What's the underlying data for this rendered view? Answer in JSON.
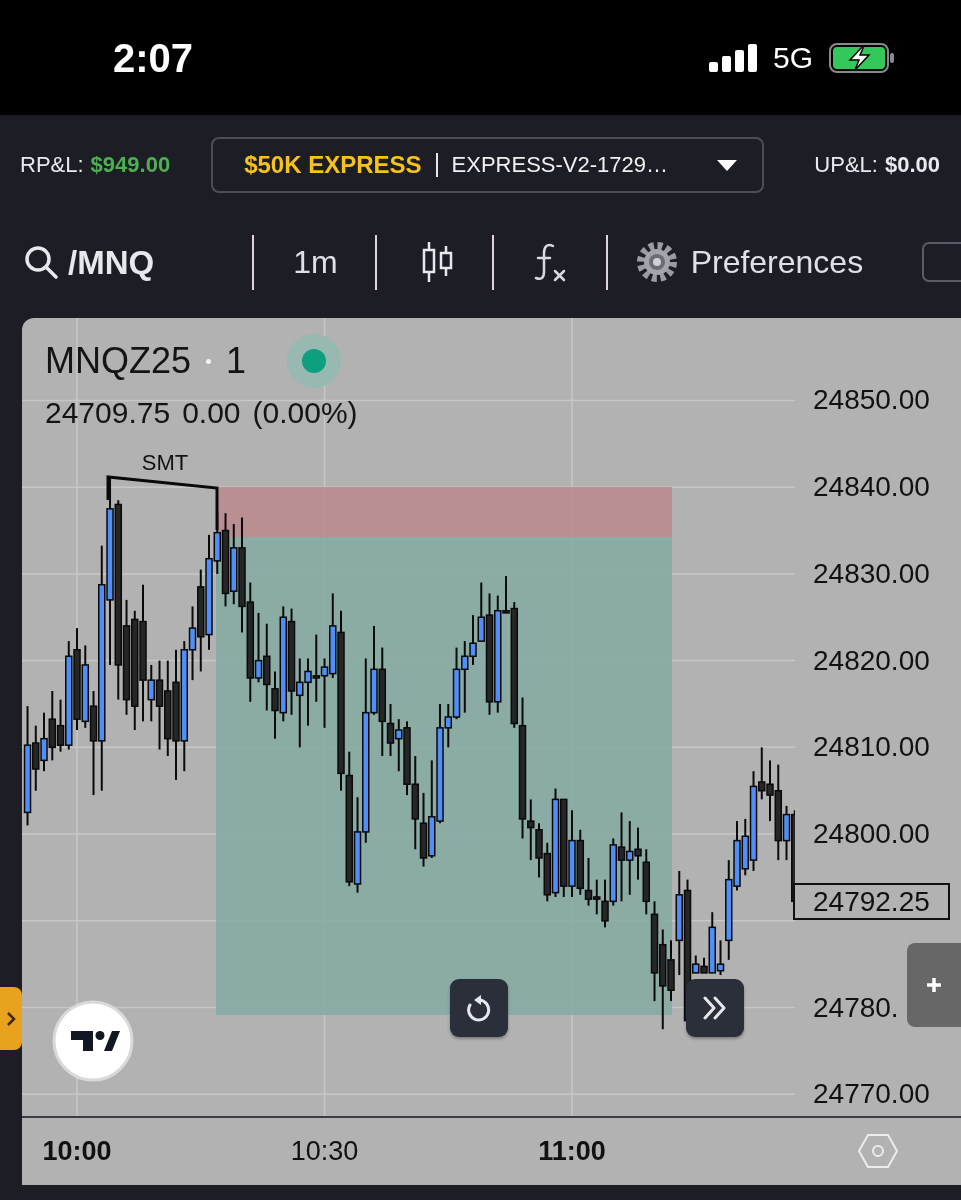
{
  "status_bar": {
    "time": "2:07",
    "network": "5G"
  },
  "header": {
    "realized_pnl": {
      "label": "RP&L:",
      "value": "$949.00"
    },
    "account": {
      "plan": "$50K EXPRESS",
      "name": "EXPRESS-V2-1729…"
    },
    "unrealized_pnl": {
      "label": "UP&L:",
      "value": "$0.00"
    }
  },
  "toolbar": {
    "symbol": "/MNQ",
    "interval": "1m",
    "preferences": "Preferences"
  },
  "chart": {
    "legend": {
      "symbol": "MNQZ25",
      "interval": "1",
      "price": "24709.75",
      "change": "0.00",
      "change_percent": "(0.00%)"
    },
    "annotation": "SMT",
    "last_price": "24792.25",
    "chart_data": {
      "type": "candlestick",
      "x": [
        594,
        595,
        596,
        597,
        598,
        599,
        600,
        601,
        602,
        603,
        604,
        605,
        606,
        607,
        608,
        609,
        610,
        611,
        612,
        613,
        614,
        615,
        616,
        617,
        618,
        619,
        620,
        621,
        622,
        623,
        624,
        625,
        626,
        627,
        628,
        629,
        630,
        631,
        632,
        633,
        634,
        635,
        636,
        637,
        638,
        639,
        640,
        641,
        642,
        643,
        644,
        645,
        646,
        647,
        648,
        649,
        650,
        651,
        652,
        653,
        654,
        655,
        656,
        657,
        658,
        659,
        660,
        661,
        662,
        663,
        664,
        665,
        666,
        667,
        668,
        669,
        670,
        671,
        672,
        673,
        674,
        675,
        676,
        677,
        678,
        679,
        680,
        681,
        682,
        683,
        684,
        685,
        686,
        687
      ],
      "ohlc": [
        [
          24802.5,
          24814.75,
          24801,
          24810.25
        ],
        [
          24810.5,
          24812.5,
          24805,
          24807.5
        ],
        [
          24808.5,
          24814,
          24807.25,
          24811
        ],
        [
          24813.25,
          24816.5,
          24808.5,
          24810
        ],
        [
          24812.5,
          24815.5,
          24809.5,
          24810.25
        ],
        [
          24810.25,
          24822.25,
          24809.75,
          24820.5
        ],
        [
          24821.25,
          24823.75,
          24812,
          24813.25
        ],
        [
          24813,
          24821.75,
          24812.25,
          24819.5
        ],
        [
          24814.75,
          24816.5,
          24804.5,
          24810.75
        ],
        [
          24810.75,
          24833.25,
          24805,
          24828.75
        ],
        [
          24827,
          24841.25,
          24819.5,
          24837.5
        ],
        [
          24838,
          24838.5,
          24815.5,
          24819.5
        ],
        [
          24824,
          24827,
          24813.75,
          24815.5
        ],
        [
          24824.75,
          24825.75,
          24812,
          24814.75
        ],
        [
          24824.5,
          24828.75,
          24813,
          24817.75
        ],
        [
          24815.5,
          24819.5,
          24813,
          24817.75
        ],
        [
          24817.75,
          24820,
          24809.75,
          24814.75
        ],
        [
          24816.5,
          24820,
          24809,
          24811
        ],
        [
          24817.5,
          24821.25,
          24806.25,
          24810.75
        ],
        [
          24810.75,
          24822.25,
          24807.25,
          24821.25
        ],
        [
          24821.25,
          24826.25,
          24817.75,
          24823.75
        ],
        [
          24828.5,
          24830.5,
          24818.75,
          24822.75
        ],
        [
          24823,
          24834.5,
          24821.25,
          24831.75
        ],
        [
          24831.5,
          24837,
          24830,
          24834.75
        ],
        [
          24835,
          24837,
          24826.25,
          24827.75
        ],
        [
          24828,
          24835.75,
          24826.5,
          24833
        ],
        [
          24833,
          24836.5,
          24823.25,
          24826.25
        ],
        [
          24826.75,
          24829,
          24815.25,
          24818
        ],
        [
          24818,
          24825.5,
          24817.5,
          24820
        ],
        [
          24820.5,
          24824.25,
          24814.25,
          24817.25
        ],
        [
          24816.75,
          24818.75,
          24811,
          24814.25
        ],
        [
          24814,
          24826.25,
          24813,
          24825
        ],
        [
          24824.5,
          24826,
          24813.75,
          24816.5
        ],
        [
          24816,
          24820.25,
          24810,
          24817.5
        ],
        [
          24817.5,
          24820.25,
          24812.5,
          24818.75
        ],
        [
          24818.25,
          24823,
          24815.25,
          24818
        ],
        [
          24818.25,
          24820.25,
          24812.25,
          24819.25
        ],
        [
          24818.5,
          24827.75,
          24818,
          24824
        ],
        [
          24823.25,
          24825.75,
          24805,
          24807
        ],
        [
          24806.75,
          24809.5,
          24794,
          24794.5
        ],
        [
          24794.25,
          24804.25,
          24793.25,
          24800.25
        ],
        [
          24800.25,
          24820.25,
          24799,
          24814
        ],
        [
          24814,
          24824,
          24813.75,
          24819
        ],
        [
          24819,
          24821.5,
          24809,
          24813
        ],
        [
          24812.75,
          24815,
          24809,
          24810.5
        ],
        [
          24811,
          24813.25,
          24807.25,
          24812
        ],
        [
          24812.25,
          24813,
          24804.5,
          24805.75
        ],
        [
          24805.75,
          24809,
          24798.25,
          24801.75
        ],
        [
          24801.25,
          24804.75,
          24796.25,
          24797.25
        ],
        [
          24797.5,
          24808.5,
          24797.25,
          24802
        ],
        [
          24801.5,
          24815,
          24801.25,
          24812.25
        ],
        [
          24812.25,
          24815,
          24810,
          24813.5
        ],
        [
          24813.5,
          24821.5,
          24813.25,
          24819
        ],
        [
          24819,
          24822.25,
          24814,
          24820.5
        ],
        [
          24820.5,
          24825.25,
          24819.5,
          24822
        ],
        [
          24822.25,
          24829,
          24822.25,
          24825
        ],
        [
          24825.25,
          24827.75,
          24813.75,
          24815.25
        ],
        [
          24815.25,
          24827.5,
          24814,
          24825.75
        ],
        [
          24825.75,
          24829.75,
          24825.5,
          24825.5
        ],
        [
          24826,
          24826.75,
          24812.25,
          24812.75
        ],
        [
          24812.5,
          24815.75,
          24799.5,
          24801.75
        ],
        [
          24801.5,
          24804,
          24797,
          24800.75
        ],
        [
          24800.5,
          24801.25,
          24795,
          24797.25
        ],
        [
          24797.75,
          24799,
          24792.25,
          24793
        ],
        [
          24793.25,
          24805.25,
          24792.75,
          24804
        ],
        [
          24804,
          24804,
          24792.75,
          24794
        ],
        [
          24794,
          24802.75,
          24792.75,
          24799.25
        ],
        [
          24799.25,
          24800.5,
          24793,
          24793.75
        ],
        [
          24793.5,
          24797.25,
          24791.75,
          24792.5
        ],
        [
          24792.75,
          24794.75,
          24790.75,
          24792.5
        ],
        [
          24792.25,
          24794.75,
          24789.25,
          24790
        ],
        [
          24792.25,
          24799.5,
          24791.75,
          24798.75
        ],
        [
          24798.5,
          24802.5,
          24792.25,
          24797
        ],
        [
          24797,
          24801.5,
          24793,
          24798
        ],
        [
          24798.25,
          24800.75,
          24794.75,
          24797.5
        ],
        [
          24796.75,
          24798.25,
          24790.75,
          24792.25
        ],
        [
          24790.75,
          24792.25,
          24780.75,
          24784
        ],
        [
          24787.25,
          24789,
          24777.5,
          24782.5
        ],
        [
          24785.5,
          24787.75,
          24780.75,
          24782
        ],
        [
          24787.75,
          24795.75,
          24783.75,
          24793
        ],
        [
          24793.5,
          24794.75,
          24778,
          24778.5
        ],
        [
          24784,
          24786,
          24784,
          24785
        ],
        [
          24784.75,
          24785.75,
          24784,
          24784
        ],
        [
          24784,
          24791,
          24784,
          24789.25
        ],
        [
          24784.25,
          24787.75,
          24783.75,
          24785
        ],
        [
          24787.75,
          24797,
          24785.5,
          24794.75
        ],
        [
          24794,
          24801.5,
          24793.5,
          24799.25
        ],
        [
          24796,
          24801.75,
          24795.25,
          24799.75
        ],
        [
          24797,
          24807.25,
          24795.75,
          24805.5
        ],
        [
          24806,
          24810,
          24804,
          24805
        ],
        [
          24805.75,
          24808.5,
          24801.5,
          24804.5
        ],
        [
          24805,
          24808,
          24797,
          24799.25
        ],
        [
          24799.25,
          24803.25,
          24797,
          24802.25
        ],
        [
          24802.25,
          24802.75,
          24791.75,
          24792.25
        ]
      ],
      "xlim": [
        593.33,
        707.15
      ],
      "ylim": [
        24767.5,
        24859.5
      ],
      "grid": true,
      "xticks": [
        {
          "value": 600,
          "label": "10:00"
        },
        {
          "value": 630,
          "label": "10:30"
        },
        {
          "value": 660,
          "label": "11:00"
        }
      ],
      "yticks": [
        {
          "value": 24850,
          "label": "24850.00"
        },
        {
          "value": 24840,
          "label": "24840.00"
        },
        {
          "value": 24830,
          "label": "24830.00"
        },
        {
          "value": 24820,
          "label": "24820.00"
        },
        {
          "value": 24810,
          "label": "24810.00"
        },
        {
          "value": 24800,
          "label": "24800.00"
        },
        {
          "value": 24780,
          "label": "24780."
        },
        {
          "value": 24770,
          "label": "24770.00"
        }
      ]
    }
  }
}
